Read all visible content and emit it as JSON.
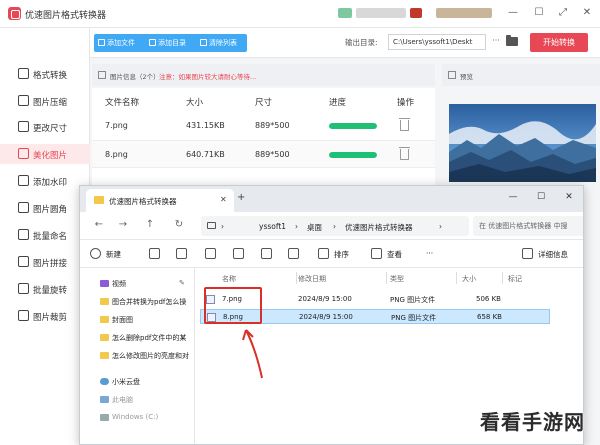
{
  "app": {
    "title": "优速图片格式转换器"
  },
  "toolbar": {
    "add_file": "添加文件",
    "add_folder": "添加目录",
    "clear_list": "清除列表",
    "output_label": "输出目录:",
    "output_path": "C:\\Users\\yssoft1\\Deskt",
    "more": "···",
    "start": "开始转换"
  },
  "sidebar": {
    "items": [
      {
        "label": "格式转换",
        "icon": "convert-icon"
      },
      {
        "label": "图片压缩",
        "icon": "compress-icon"
      },
      {
        "label": "更改尺寸",
        "icon": "resize-icon"
      },
      {
        "label": "美化图片",
        "icon": "beautify-icon",
        "active": true
      },
      {
        "label": "添加水印",
        "icon": "watermark-icon"
      },
      {
        "label": "图片圆角",
        "icon": "round-corner-icon"
      },
      {
        "label": "批量命名",
        "icon": "rename-icon"
      },
      {
        "label": "图片拼接",
        "icon": "stitch-icon"
      },
      {
        "label": "批量旋转",
        "icon": "rotate-icon"
      },
      {
        "label": "图片裁剪",
        "icon": "crop-icon"
      }
    ]
  },
  "info": {
    "label": "图片信息（2个）",
    "notice": "注意：如果图片较大请耐心等待..."
  },
  "preview": {
    "label": "预览"
  },
  "table": {
    "headers": [
      "文件名称",
      "大小",
      "尺寸",
      "进度",
      "操作"
    ],
    "rows": [
      {
        "name": "7.png",
        "size": "431.15KB",
        "dims": "889*500",
        "progress": 1.0
      },
      {
        "name": "8.png",
        "size": "640.71KB",
        "dims": "889*500",
        "progress": 1.0
      }
    ]
  },
  "explorer": {
    "tab_title": "优速图片格式转换器",
    "close": "✕",
    "new_tab": "+",
    "window_controls": [
      "—",
      "☐",
      "✕"
    ],
    "nav": [
      "←",
      "→",
      "↑",
      "↻"
    ],
    "breadcrumb": [
      "yssoft1",
      "›",
      "桌面",
      "›",
      "优速图片格式转换器",
      "›"
    ],
    "search_placeholder": "在 优速图片格式转换器 中搜",
    "commands": {
      "new": "新建",
      "sort": "排序",
      "view": "查看",
      "more": "···",
      "details": "详细信息"
    },
    "nav_items": [
      {
        "label": "视频",
        "pinned": true,
        "icon": "video-folder-icon"
      },
      {
        "label": "图合并转换为pdf怎么操",
        "icon": "folder-icon"
      },
      {
        "label": "封面图",
        "icon": "folder-icon"
      },
      {
        "label": "怎么删除pdf文件中的某",
        "icon": "folder-icon"
      },
      {
        "label": "怎么修改图片的亮度和对",
        "icon": "folder-icon"
      },
      {
        "label": "小米云盘",
        "icon": "cloud-icon"
      },
      {
        "label": "此电脑",
        "icon": "pc-icon"
      },
      {
        "label": "Windows (C:)",
        "icon": "drive-icon"
      }
    ],
    "file_headers": [
      "名称",
      "修改日期",
      "类型",
      "大小",
      "标记"
    ],
    "files": [
      {
        "name": "7.png",
        "date": "2024/8/9 15:00",
        "type": "PNG 图片文件",
        "size": "506 KB",
        "selected": false
      },
      {
        "name": "8.png",
        "date": "2024/8/9 15:00",
        "type": "PNG 图片文件",
        "size": "658 KB",
        "selected": true
      }
    ]
  },
  "watermark": "看看手游网",
  "colors": {
    "accent_red": "#e84855",
    "toolbar_blue": "#3fa9f5",
    "progress_green": "#1fbf75",
    "selection_blue": "#cce8ff",
    "annotation_red": "#d93025"
  }
}
